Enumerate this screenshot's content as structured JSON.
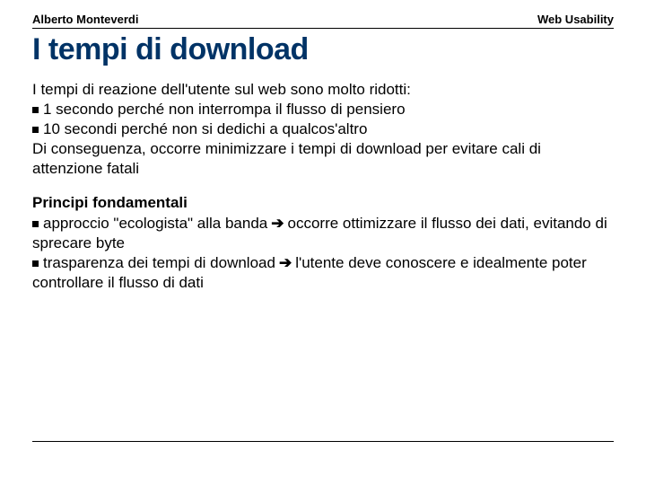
{
  "header": {
    "author": "Alberto Monteverdi",
    "topic": "Web Usability"
  },
  "title": "I tempi di download",
  "para1": {
    "intro": "I tempi di reazione dell'utente sul web sono molto ridotti:",
    "b1": "1 secondo perché non interrompa il flusso di pensiero",
    "b2": "10 secondi perché non si dedichi a qualcos'altro",
    "trail": "Di conseguenza, occorre minimizzare i tempi di download per evitare cali di attenzione fatali"
  },
  "para2": {
    "heading": "Principi fondamentali",
    "b1a": "approccio \"ecologista\" alla banda",
    "b1b": "occorre ottimizzare il flusso dei dati, evitando di sprecare byte",
    "b2a": "trasparenza dei tempi di download",
    "b2b": "l'utente deve conoscere e idealmente poter controllare il flusso di dati"
  },
  "glyphs": {
    "arrow": "➔"
  }
}
